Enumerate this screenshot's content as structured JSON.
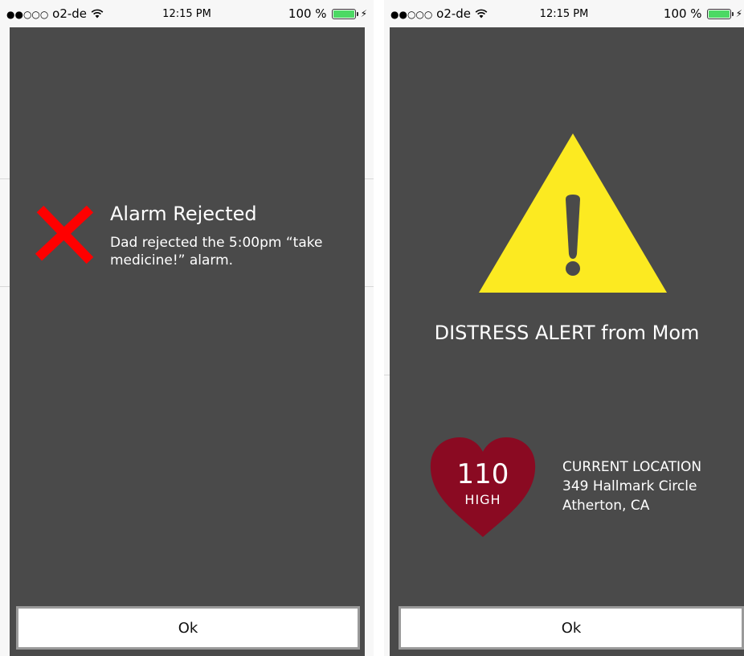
{
  "colors": {
    "modal_bg": "#4a4a4a",
    "reject_red": "#ff0000",
    "warning_yellow": "#fcea21",
    "heart_red": "#8a0a22",
    "battery_green": "#4cd964"
  },
  "left_screen": {
    "status_bar": {
      "signal_dots": "●●○○○",
      "carrier": "o2-de",
      "wifi_icon": "wifi-icon",
      "time": "12:15 PM",
      "battery_percent": "100 %",
      "battery_level": 1.0
    },
    "alert": {
      "icon": "x-icon",
      "title": "Alarm Rejected",
      "message": "Dad rejected the 5:00pm “take medicine!” alarm."
    },
    "ok_label": "Ok"
  },
  "right_screen": {
    "status_bar": {
      "signal_dots": "●●○○○",
      "carrier": "o2-de",
      "wifi_icon": "wifi-icon",
      "time": "12:15 PM",
      "battery_percent": "100 %",
      "battery_level": 1.0
    },
    "alert": {
      "icon": "warning-icon",
      "title": "DISTRESS ALERT from Mom"
    },
    "heart_rate": {
      "value": "110",
      "status": "HIGH"
    },
    "location": {
      "label": "CURRENT LOCATION",
      "address_line1": "349 Hallmark Circle",
      "address_line2": "Atherton, CA"
    },
    "ok_label": "Ok"
  }
}
